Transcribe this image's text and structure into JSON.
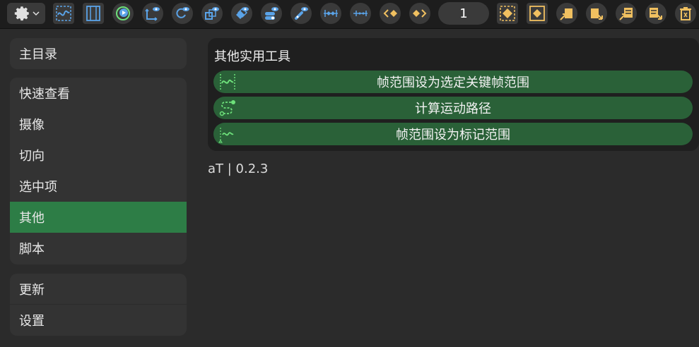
{
  "toolbar": {
    "frame_value": "1",
    "icons": [
      "gear-icon",
      "graph-editor-icon",
      "frame-range-icon",
      "play-cycle-icon",
      "axis-view-icon",
      "rotate-view-icon",
      "scale-view-icon",
      "copy-view-icon",
      "toggle-view-icon",
      "link-view-icon",
      "key-spread-icon",
      "key-compress-icon",
      "key-left-icon",
      "key-right-icon",
      "select-all-keys-icon",
      "select-key-icon",
      "copy-key-icon",
      "paste-key-icon",
      "copy-anim-icon",
      "paste-anim-icon",
      "delete-icon"
    ]
  },
  "sidebar": {
    "main_menu": "主目录",
    "items": [
      "快速查看",
      "摄像",
      "切向",
      "选中项",
      "其他",
      "脚本"
    ],
    "active_index": 4,
    "bottom": [
      "更新",
      "设置"
    ]
  },
  "main": {
    "section_title": "其他实用工具",
    "buttons": [
      {
        "label": "帧范围设为选定关键帧范围",
        "icon": "wave-range-icon"
      },
      {
        "label": "计算运动路径",
        "icon": "motion-path-icon"
      },
      {
        "label": "帧范围设为标记范围",
        "icon": "marker-range-icon"
      }
    ],
    "version": "aT | 0.2.3"
  },
  "colors": {
    "accent": "#2d7d46",
    "button": "#2a6138",
    "icon_blue": "#5aa3e8",
    "icon_orange": "#f0c060",
    "icon_green": "#6de07a"
  }
}
